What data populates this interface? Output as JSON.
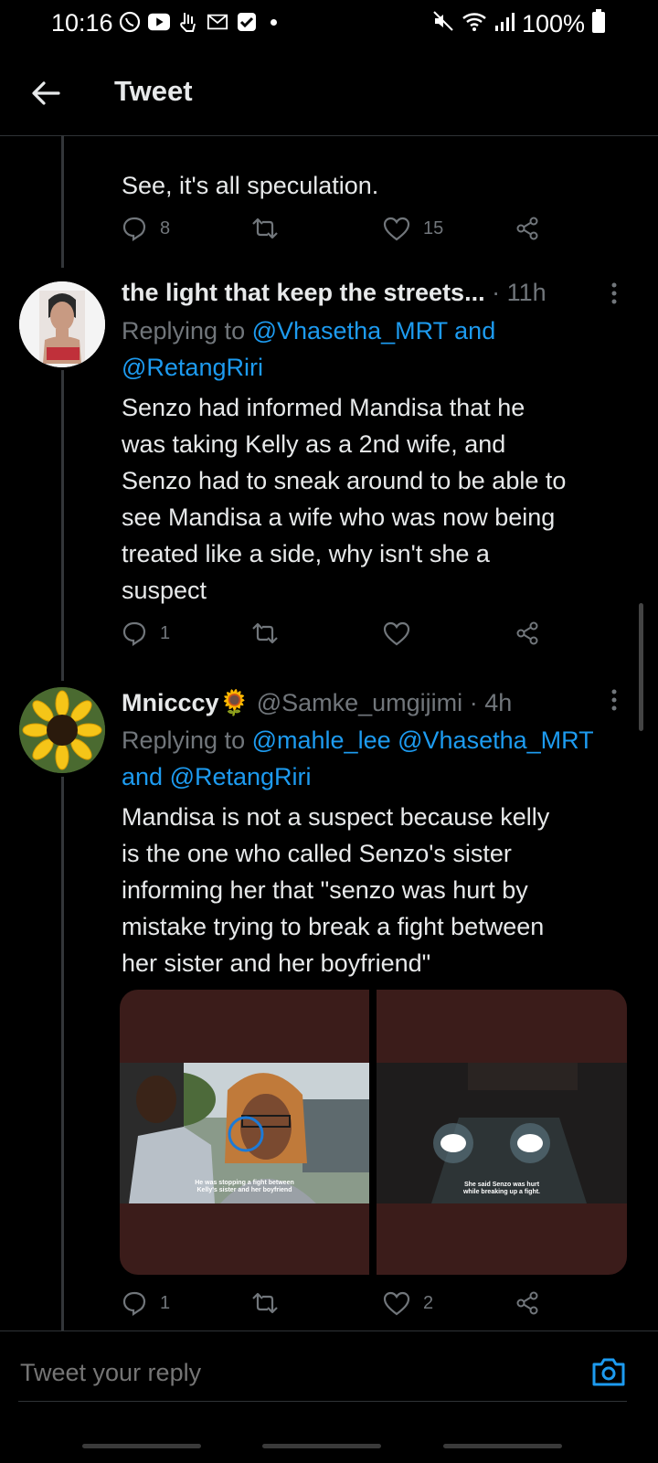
{
  "status_bar": {
    "time": "10:16",
    "battery": "100%",
    "notification_icons": [
      "whatsapp-icon",
      "youtube-icon",
      "hand-icon",
      "gmail-icon",
      "check-icon"
    ],
    "system_icons": [
      "mute-icon",
      "wifi-icon",
      "signal-icon",
      "battery-icon"
    ]
  },
  "header": {
    "title": "Tweet"
  },
  "colors": {
    "accent": "#1d9bf0",
    "muted": "#71767b",
    "background": "#000000",
    "media_bg": "#3b1c1a"
  },
  "tweets": [
    {
      "text": "See, it's all speculation.",
      "actions": {
        "replies": "8",
        "retweets": "",
        "likes": "15"
      }
    },
    {
      "author": "the light that keep the streets...",
      "separator": "·",
      "time": "11h",
      "replying_prefix": "Replying to",
      "replying_to": [
        "@Vhasetha_MRT",
        "@RetangRiri"
      ],
      "replying_join": "and",
      "text_lines": [
        "Senzo had informed Mandisa that he",
        "was taking Kelly as a 2nd wife, and",
        "Senzo had to sneak around to be able to",
        "see Mandisa a wife who was now being",
        "treated like a side, why isn't she a",
        "suspect"
      ],
      "actions": {
        "replies": "1",
        "retweets": "",
        "likes": ""
      }
    },
    {
      "author": "Mnicccy",
      "author_emoji": "🌻",
      "handle": "@Samke_umgijimi",
      "separator": "·",
      "time": "4h",
      "replying_prefix": "Replying to",
      "replying_to": [
        "@mahle_lee",
        "@Vhasetha_MRT",
        "@RetangRiri"
      ],
      "replying_join": "and",
      "text_lines": [
        "Mandisa is not a suspect because kelly",
        "is the one who called Senzo's sister",
        "informing her that \"senzo was hurt by",
        "mistake trying to break a fight between",
        "her sister and her boyfriend\""
      ],
      "media": [
        {
          "caption_lines": [
            "He was stopping a fight between",
            "Kelly's sister and her boyfriend"
          ]
        },
        {
          "caption_lines": [
            "She said Senzo was hurt",
            "while breaking up a fight."
          ]
        }
      ],
      "actions": {
        "replies": "1",
        "retweets": "",
        "likes": "2"
      }
    }
  ],
  "reply_box": {
    "placeholder": "Tweet your reply"
  }
}
